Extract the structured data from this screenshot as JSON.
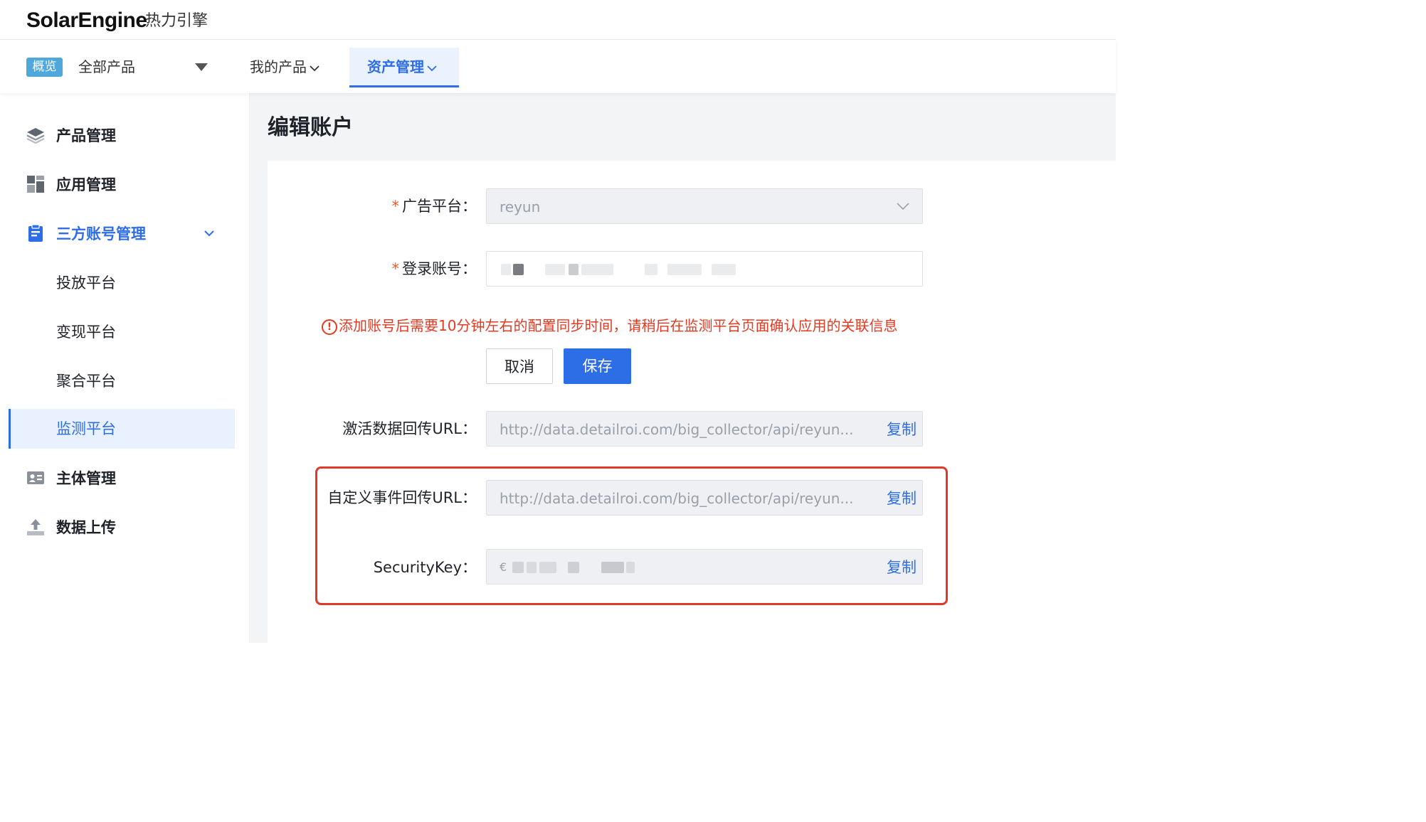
{
  "brand": {
    "name_en": "SolarEngine",
    "name_zh": "热力引擎"
  },
  "nav": {
    "badge": "概览",
    "product_select": "全部产品",
    "items": [
      {
        "label": "我的产品"
      },
      {
        "label": "资产管理"
      }
    ]
  },
  "sidebar": {
    "items": [
      {
        "label": "产品管理",
        "icon": "layers-icon"
      },
      {
        "label": "应用管理",
        "icon": "apps-grid-icon"
      },
      {
        "label": "三方账号管理",
        "icon": "clipboard-icon",
        "expanded": true,
        "children": [
          {
            "label": "投放平台"
          },
          {
            "label": "变现平台"
          },
          {
            "label": "聚合平台"
          },
          {
            "label": "监测平台",
            "active": true
          }
        ]
      },
      {
        "label": "主体管理",
        "icon": "id-card-icon"
      },
      {
        "label": "数据上传",
        "icon": "upload-icon"
      }
    ]
  },
  "page": {
    "title": "编辑账户"
  },
  "form": {
    "ad_platform": {
      "label": "广告平台：",
      "value": "reyun"
    },
    "login_account": {
      "label": "登录账号："
    },
    "warning": "添加账号后需要10分钟左右的配置同步时间，请稍后在监测平台页面确认应用的关联信息",
    "cancel_label": "取消",
    "save_label": "保存",
    "activation_url": {
      "label": "激活数据回传URL：",
      "value": "http://data.detailroi.com/big_collector/api/reyun...",
      "copy_label": "复制"
    },
    "custom_event_url": {
      "label": "自定义事件回传URL：",
      "value": "http://data.detailroi.com/big_collector/api/reyun...",
      "copy_label": "复制"
    },
    "security_key": {
      "label": "SecurityKey：",
      "value": "€",
      "copy_label": "复制"
    }
  },
  "colors": {
    "accent": "#2d6de6",
    "badge": "#4fa8dc",
    "warning": "#e53a22",
    "required": "#f0581e",
    "highlight_box": "#e0392b"
  }
}
